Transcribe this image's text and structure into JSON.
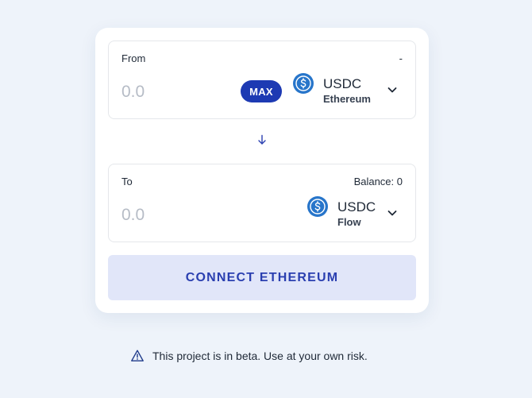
{
  "from": {
    "label": "From",
    "right_label": "-",
    "amount_placeholder": "0.0",
    "max_label": "MAX",
    "token": {
      "symbol": "USDC",
      "network": "Ethereum",
      "icon": "usdc-icon"
    }
  },
  "to": {
    "label": "To",
    "balance_label": "Balance: 0",
    "amount_placeholder": "0.0",
    "token": {
      "symbol": "USDC",
      "network": "Flow",
      "icon": "usdc-icon"
    }
  },
  "connect_button_label": "CONNECT ETHEREUM",
  "notice": {
    "icon": "warning-icon",
    "text": "This project is in beta. Use at your own risk."
  },
  "colors": {
    "accent": "#1d3ab3",
    "usdc_blue": "#2775ca",
    "button_bg": "#e1e6f9",
    "button_text": "#2a3fb0",
    "page_bg": "#eef3fa"
  }
}
